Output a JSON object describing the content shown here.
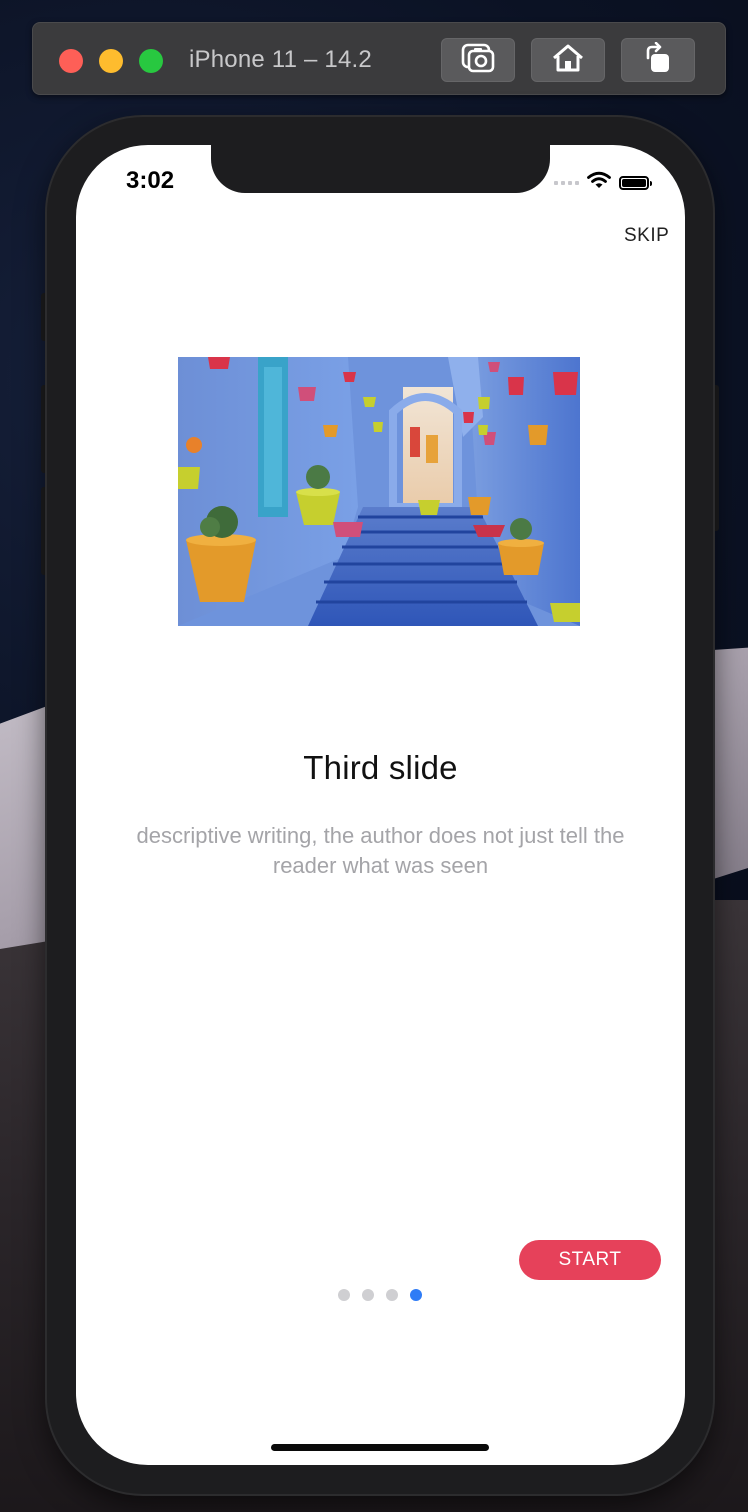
{
  "simulator": {
    "title": "iPhone 11 – 14.2",
    "buttons": {
      "screenshot": "screenshot",
      "home": "home",
      "rotate": "rotate"
    }
  },
  "status_bar": {
    "time": "3:02"
  },
  "onboarding": {
    "skip_label": "SKIP",
    "title": "Third slide",
    "description": "descriptive writing, the author does not just tell the reader what was seen",
    "start_label": "START",
    "pagination": {
      "total": 4,
      "active_index": 3
    }
  },
  "colors": {
    "accent": "#e6415a",
    "active_dot": "#2f7cf6",
    "inactive_dot": "#cfcfd2"
  }
}
